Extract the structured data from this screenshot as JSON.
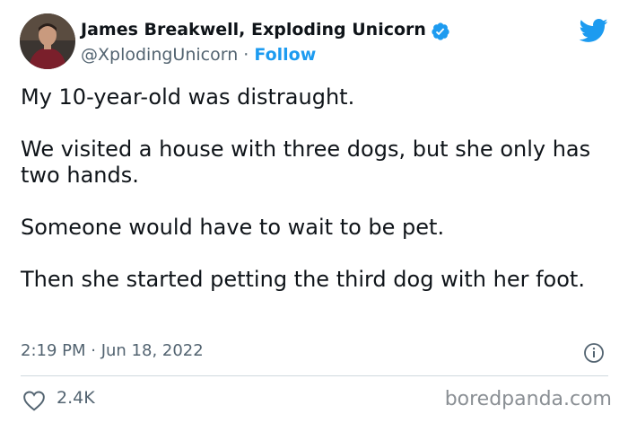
{
  "author": {
    "display_name": "James Breakwell, Exploding Unicorn",
    "handle": "@XplodingUnicorn",
    "separator": "·",
    "follow_label": "Follow",
    "verified": true
  },
  "tweet": {
    "paragraphs": [
      "My 10-year-old was distraught.",
      "We visited a house with three dogs, but she only has two hands.",
      "Someone would have to wait to be pet.",
      "Then she started petting the third dog with her foot."
    ],
    "timestamp": "2:19 PM · Jun 18, 2022",
    "likes": "2.4K"
  },
  "watermark": "boredpanda.com",
  "colors": {
    "accent": "#1d9bf0",
    "text": "#0f1419",
    "secondary": "#536471",
    "divider": "#cfd9de"
  },
  "icons": {
    "verified": "verified-badge-icon",
    "brand": "twitter-bird-icon",
    "info": "info-icon",
    "like": "heart-icon"
  }
}
